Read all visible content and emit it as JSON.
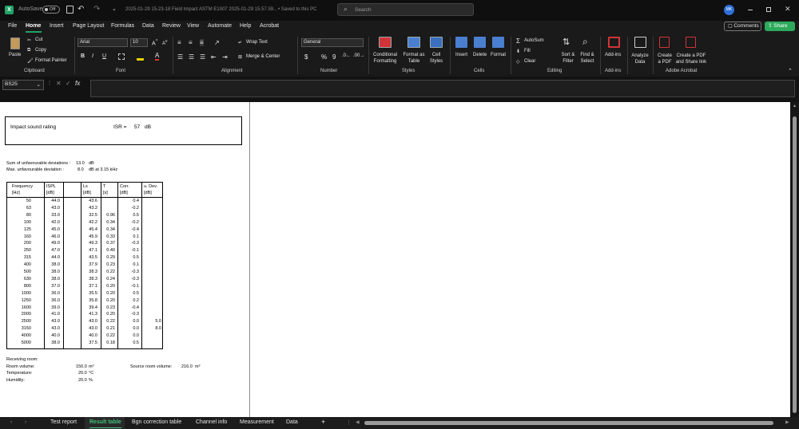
{
  "titlebar": {
    "autosave_label": "AutoSave",
    "autosave_state": "Off",
    "filename": "2025-01-29 15-23-18 Field Impact ASTM E1007 2025-01-29 15.57.59...",
    "saved_status": "• Saved to this PC",
    "search_placeholder": "Search",
    "avatar_initials": "MK"
  },
  "menu": {
    "tabs": [
      "File",
      "Home",
      "Insert",
      "Page Layout",
      "Formulas",
      "Data",
      "Review",
      "View",
      "Automate",
      "Help",
      "Acrobat"
    ],
    "active": "Home",
    "comments": "Comments",
    "share": "Share"
  },
  "ribbon": {
    "clipboard": {
      "paste": "Paste",
      "cut": "Cut",
      "copy": "Copy",
      "format_painter": "Format Painter",
      "label": "Clipboard"
    },
    "font": {
      "name": "Arial",
      "size": "10",
      "label": "Font"
    },
    "alignment": {
      "wrap": "Wrap Text",
      "merge": "Merge & Center",
      "label": "Alignment"
    },
    "number": {
      "format": "General",
      "label": "Number"
    },
    "styles": {
      "conditional": "Conditional Formatting",
      "format_table": "Format as Table",
      "cell_styles": "Cell Styles",
      "label": "Styles"
    },
    "cells": {
      "insert": "Insert",
      "delete": "Delete",
      "format": "Format",
      "label": "Cells"
    },
    "editing": {
      "autosum": "AutoSum",
      "fill": "Fill",
      "clear": "Clear",
      "sort_filter": "Sort & Filter",
      "find_select": "Find & Select",
      "label": "Editing"
    },
    "addins": {
      "addins": "Add-ins",
      "label": "Add-ins"
    },
    "analyze": {
      "label": "Analyze Data"
    },
    "acrobat": {
      "create_pdf": "Create a PDF",
      "create_share": "Create a PDF and Share link",
      "label": "Adobe Acrobat"
    }
  },
  "formula_bar": {
    "name_box": "BS25",
    "fx": "fx",
    "value": ""
  },
  "report": {
    "rating_label": "Impact sound rating",
    "isr_label": "ISR =",
    "isr_value": "57",
    "isr_unit": "dB",
    "sum_label": "Sum of unfavourable deviations :",
    "sum_value": "13.0",
    "sum_unit": "dB",
    "max_label": "Max. unfavourable deviation :",
    "max_value": "8.0",
    "max_unit": "dB  at  3.15 kHz",
    "headers": [
      [
        "Frequency",
        "[Hz]"
      ],
      [
        "ISPL",
        "[dB]"
      ],
      [
        "",
        ""
      ],
      [
        "Ls",
        "[dB]"
      ],
      [
        "T",
        "[s]"
      ],
      [
        "Corr.",
        "[dB]"
      ],
      [
        "u. Dev.",
        "[dB]"
      ]
    ],
    "rows": [
      [
        "50",
        "44.0",
        "",
        "43.6",
        "",
        "0.4",
        ""
      ],
      [
        "63",
        "43.0",
        "",
        "43.2",
        "",
        "-0.2",
        ""
      ],
      [
        "80",
        "33.0",
        "",
        "32.5",
        "0.96",
        "0.5",
        ""
      ],
      [
        "100",
        "42.0",
        "",
        "42.2",
        "0.34",
        "-0.2",
        ""
      ],
      [
        "125",
        "45.0",
        "",
        "45.4",
        "0.34",
        "-0.4",
        ""
      ],
      [
        "160",
        "46.0",
        "",
        "45.9",
        "0.33",
        "0.1",
        ""
      ],
      [
        "200",
        "49.0",
        "",
        "49.3",
        "0.37",
        "-0.3",
        ""
      ],
      [
        "250",
        "47.0",
        "",
        "47.1",
        "0.40",
        "-0.1",
        ""
      ],
      [
        "315",
        "44.0",
        "",
        "43.5",
        "0.29",
        "0.5",
        ""
      ],
      [
        "400",
        "38.0",
        "",
        "37.9",
        "0.23",
        "0.1",
        ""
      ],
      [
        "500",
        "38.0",
        "",
        "38.3",
        "0.22",
        "-0.3",
        ""
      ],
      [
        "630",
        "38.0",
        "",
        "38.3",
        "0.24",
        "-0.3",
        ""
      ],
      [
        "800",
        "37.0",
        "",
        "37.1",
        "0.20",
        "-0.1",
        ""
      ],
      [
        "1000",
        "36.0",
        "",
        "35.5",
        "0.20",
        "0.5",
        ""
      ],
      [
        "1250",
        "36.0",
        "",
        "35.8",
        "0.20",
        "0.2",
        ""
      ],
      [
        "1600",
        "39.0",
        "",
        "39.4",
        "0.23",
        "-0.4",
        ""
      ],
      [
        "2000",
        "41.0",
        "",
        "41.3",
        "0.20",
        "-0.3",
        ""
      ],
      [
        "2500",
        "43.0",
        "",
        "43.0",
        "0.22",
        "0.0",
        "5.0"
      ],
      [
        "3150",
        "43.0",
        "",
        "43.0",
        "0.21",
        "0.0",
        "8.0"
      ],
      [
        "4000",
        "40.0",
        "",
        "40.0",
        "0.22",
        "0.0",
        ""
      ],
      [
        "5000",
        "38.0",
        "",
        "37.5",
        "0.18",
        "0.5",
        ""
      ]
    ],
    "receiving_label": "Receiving room:",
    "room_volume_label": "Room volume:",
    "room_volume_value": "150.0",
    "room_volume_unit": "m³",
    "temp_label": "Temperature:",
    "temp_value": "20.0",
    "temp_unit": "°C",
    "hum_label": "Humidity:",
    "hum_value": "20.0",
    "hum_unit": "%",
    "source_label": "Source room volume:",
    "source_value": "216.0",
    "source_unit": "m³"
  },
  "sheet_tabs": {
    "tabs": [
      "Test report",
      "Result table",
      "Bgn correction table",
      "Channel info",
      "Measurement",
      "Data"
    ],
    "active": "Result table",
    "add": "+"
  },
  "colors": {
    "accent": "#21a366",
    "share_green": "#2eaa5c",
    "avatar": "#2f6fd6"
  }
}
